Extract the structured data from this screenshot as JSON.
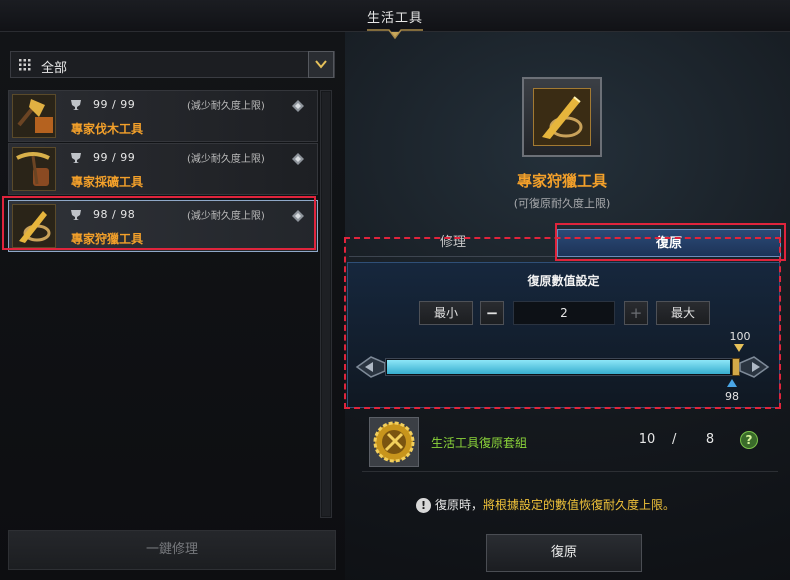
{
  "window": {
    "title": "生活工具"
  },
  "filter": {
    "selected": "全部"
  },
  "tools": [
    {
      "durability": "99 / 99",
      "note": "(減少耐久度上限)",
      "name": "專家伐木工具",
      "icon": "axe-icon"
    },
    {
      "durability": "99 / 99",
      "note": "(減少耐久度上限)",
      "name": "專家採礦工具",
      "icon": "pickaxe-icon"
    },
    {
      "durability": "98 / 98",
      "note": "(減少耐久度上限)",
      "name": "專家狩獵工具",
      "icon": "hunting-tool-icon"
    }
  ],
  "repair_all_label": "一鍵修理",
  "selected_tool": {
    "name": "專家狩獵工具",
    "subtitle": "(可復原耐久度上限)"
  },
  "tabs": {
    "repair": "修理",
    "restore": "復原"
  },
  "restore": {
    "settings_title": "復原數值設定",
    "min_label": "最小",
    "minus": "−",
    "value": "2",
    "plus": "+",
    "max_label": "最大",
    "slider_max": "100",
    "slider_current": "98",
    "slider_fraction": 0.98
  },
  "material": {
    "name": "生活工具復原套組",
    "have": "10",
    "slash": "/",
    "need": "8",
    "help": "?"
  },
  "notice": {
    "part1": "復原時，",
    "part2": "將根據設定的數值恢復耐久度上限。"
  },
  "restore_button": "復原",
  "colors": {
    "highlight": "#e0243c",
    "item_name": "#f3a02a",
    "material_name": "#8bd43a",
    "slider": "#37aecf"
  }
}
